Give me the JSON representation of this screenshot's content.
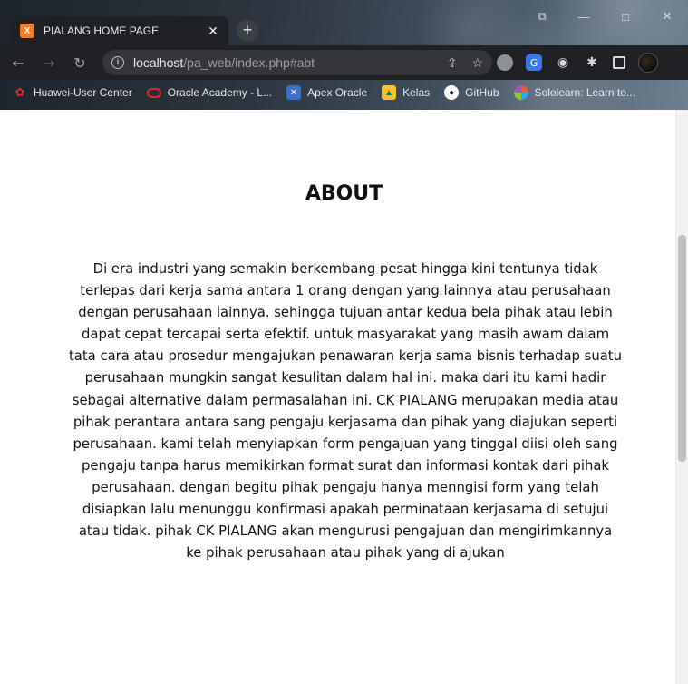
{
  "browser": {
    "tab": {
      "favicon_text": "X",
      "title": "PIALANG HOME PAGE",
      "close": "✕"
    },
    "new_tab": "+",
    "window_controls": [
      "⧉",
      "—",
      "□",
      "✕"
    ],
    "nav": {
      "back": "←",
      "forward": "→",
      "reload": "↻"
    },
    "address": {
      "host": "localhost",
      "path": "/pa_web/index.php#abt",
      "info": "i"
    },
    "omnibox_icons": {
      "share": "⇪",
      "bookmark": "☆"
    },
    "bookmarks": [
      {
        "label": "Huawei-User Center",
        "icon": "huawei-icon"
      },
      {
        "label": "Oracle Academy - L...",
        "icon": "oracle-icon"
      },
      {
        "label": "Apex Oracle",
        "icon": "apex-icon"
      },
      {
        "label": "Kelas",
        "icon": "kelas-icon"
      },
      {
        "label": "GitHub",
        "icon": "github-icon"
      },
      {
        "label": "Sololearn: Learn to...",
        "icon": "sololearn-icon"
      }
    ]
  },
  "page": {
    "title": "ABOUT",
    "body": "Di era industri yang semakin berkembang pesat hingga kini tentunya tidak terlepas dari kerja sama antara 1 orang dengan yang lainnya atau perusahaan dengan perusahaan lainnya. sehingga tujuan antar kedua bela pihak atau lebih dapat cepat tercapai serta efektif. untuk masyarakat yang masih awam dalam tata cara atau prosedur mengajukan penawaran kerja sama bisnis terhadap suatu perusahaan mungkin sangat kesulitan dalam hal ini. maka dari itu kami hadir sebagai alternative dalam permasalahan ini. CK PIALANG merupakan media atau pihak perantara antara sang pengaju kerjasama dan pihak yang diajukan seperti perusahaan. kami telah menyiapkan form pengajuan yang tinggal diisi oleh sang pengaju tanpa harus memikirkan format surat dan informasi kontak dari pihak perusahaan. dengan begitu pihak pengaju hanya menngisi form yang telah disiapkan lalu menunggu konfirmasi apakah perminataan kerjasama di setujui atau tidak. pihak CK PIALANG akan mengurusi pengajuan dan mengirimkannya ke pihak perusahaan atau pihak yang di ajukan"
  },
  "colors": {
    "chrome_dark": "#202124",
    "omnibox": "#35363a",
    "favicon": "#fb7a24",
    "page_bg": "#ffffff",
    "text": "#111111"
  }
}
